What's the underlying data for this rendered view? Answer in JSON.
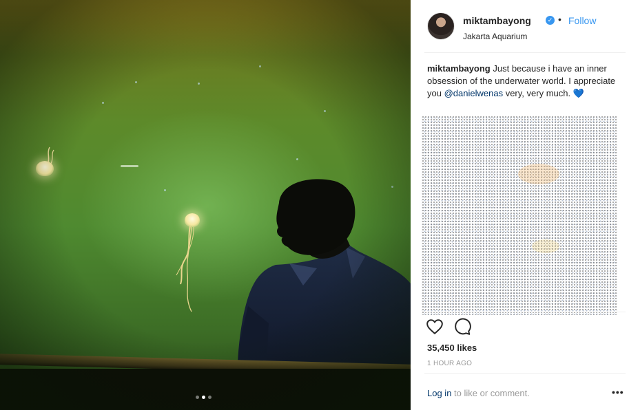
{
  "post": {
    "username": "miktambayong",
    "bullet": "•",
    "follow_label": "Follow",
    "location": "Jakarta Aquarium",
    "caption": {
      "username": "miktambayong",
      "text_before": "Just because i have an inner obsession of the underwater world. I appreciate you",
      "mention": "@danielwenas",
      "text_after": "very, very much.",
      "emoji": "💙"
    },
    "likes": "35,450 likes",
    "timestamp": "1 HOUR AGO",
    "footer": {
      "login_label": "Log in",
      "rest": "to like or comment."
    },
    "more_label": "•••",
    "carousel": {
      "count": 3,
      "active_index": 1
    }
  },
  "icons": {
    "verified": "verified-badge-icon",
    "like": "heart-outline-icon",
    "comment": "comment-bubble-icon",
    "more": "more-options-icon"
  },
  "colors": {
    "link": "#3897f0",
    "mention": "#003569",
    "muted": "#999999",
    "text": "#262626"
  }
}
